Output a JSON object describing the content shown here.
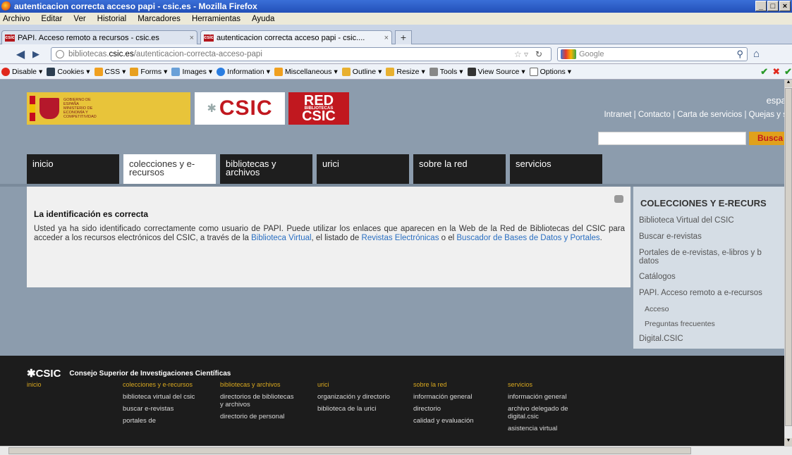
{
  "window": {
    "title": "autenticacion correcta acceso papi - csic.es - Mozilla Firefox"
  },
  "menu": [
    "Archivo",
    "Editar",
    "Ver",
    "Historial",
    "Marcadores",
    "Herramientas",
    "Ayuda"
  ],
  "tabs": [
    {
      "favicon": "csic",
      "label": "PAPI. Acceso remoto a recursos - csic.es"
    },
    {
      "favicon": "csic",
      "label": "autenticacion correcta acceso papi - csic...."
    }
  ],
  "address": {
    "host": "bibliotecas.",
    "domain": "csic.es",
    "path": "/autenticacion-correcta-acceso-papi"
  },
  "search_engine": "Google",
  "dev_toolbar": [
    "Disable",
    "Cookies",
    "CSS",
    "Forms",
    "Images",
    "Information",
    "Miscellaneous",
    "Outline",
    "Resize",
    "Tools",
    "View Source",
    "Options"
  ],
  "header": {
    "gov_logo_text": "GOBIERNO DE ESPAÑA  MINISTERIO DE ECONOMÍA Y COMPETITIVIDAD",
    "csic_logo": "CSIC",
    "red_logo_top": "RED",
    "red_logo_mid": "BIBLIOTECAS",
    "red_logo_bottom": "CSIC",
    "language": "españ",
    "links": "Intranet | Contacto | Carta de servicios | Quejas y s",
    "search_button": "Busca"
  },
  "nav": [
    {
      "label": "inicio"
    },
    {
      "label": "colecciones y e-recursos"
    },
    {
      "label": "bibliotecas y archivos"
    },
    {
      "label": "urici"
    },
    {
      "label": "sobre la red"
    },
    {
      "label": "servicios"
    }
  ],
  "content": {
    "title": "La identificación es correcta",
    "text_1": "Usted ya ha sido identificado correctamente como usuario de PAPI. Puede utilizar los enlaces que aparecen en la Web de la Red de Bibliotecas del CSIC para acceder a los recursos electrónicos del CSIC, a través de la ",
    "link_1": "Biblioteca Virtual",
    "text_2": ", el listado de ",
    "link_2": "Revistas Electrónicas",
    "text_3": " o el ",
    "link_3": "Buscador de Bases de Datos y Portales",
    "text_4": "."
  },
  "sidebar": {
    "title": "COLECCIONES Y E-RECURS",
    "items": [
      "Biblioteca Virtual del CSIC",
      "Buscar e-revistas",
      "Portales de e-revistas, e-libros y b datos",
      "Catálogos",
      "PAPI. Acceso remoto a e-recursos",
      "Acceso",
      "Preguntas frecuentes",
      "Digital.CSIC"
    ]
  },
  "footer": {
    "csic": "CSIC",
    "full_name": "Consejo Superior de Investigaciones Científicas",
    "columns": [
      {
        "head": "inicio",
        "links": []
      },
      {
        "head": "colecciones y e-recursos",
        "links": [
          "biblioteca virtual del csic",
          "buscar e-revistas",
          "portales de"
        ]
      },
      {
        "head": "bibliotecas y archivos",
        "links": [
          "directorios de bibliotecas y archivos",
          "directorio de personal"
        ]
      },
      {
        "head": "urici",
        "links": [
          "organización y directorio",
          "biblioteca de la urici"
        ]
      },
      {
        "head": "sobre la red",
        "links": [
          "información general",
          "directorio",
          "calidad y evaluación"
        ]
      },
      {
        "head": "servicios",
        "links": [
          "información general",
          "archivo delegado de digital.csic",
          "asistencia virtual"
        ]
      }
    ]
  }
}
